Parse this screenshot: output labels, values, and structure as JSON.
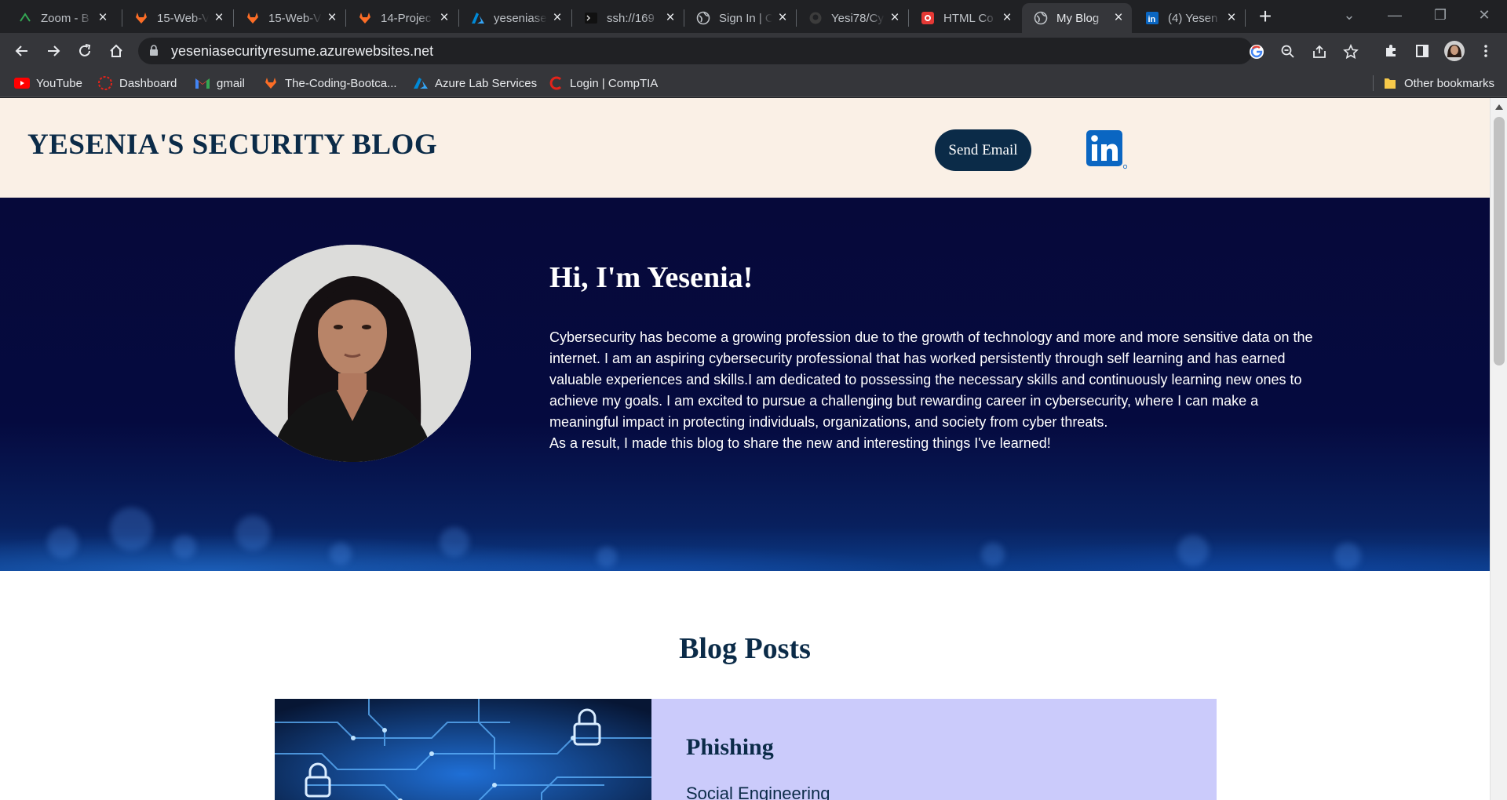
{
  "browser": {
    "tabs": [
      {
        "title": "Zoom - B",
        "icon": "zoom-icon",
        "color": "#2d8cff"
      },
      {
        "title": "15-Web-V",
        "icon": "gitlab-icon",
        "color": "#fc6d26"
      },
      {
        "title": "15-Web-V",
        "icon": "gitlab-icon",
        "color": "#fc6d26"
      },
      {
        "title": "14-Projec",
        "icon": "gitlab-icon",
        "color": "#fc6d26"
      },
      {
        "title": "yeseniase",
        "icon": "azure-icon",
        "color": "#0078d4"
      },
      {
        "title": "ssh://169",
        "icon": "terminal-icon",
        "color": "#1e1e1e"
      },
      {
        "title": "Sign In | C",
        "icon": "globe-icon",
        "color": "#bdc1c6"
      },
      {
        "title": "Yesi78/Cy",
        "icon": "github-icon",
        "color": "#5f6368"
      },
      {
        "title": "HTML Co",
        "icon": "record-icon",
        "color": "#e53935"
      },
      {
        "title": "My Blog",
        "icon": "globe-icon",
        "color": "#bdc1c6",
        "active": true
      },
      {
        "title": "(4) Yesen",
        "icon": "linkedin-icon",
        "color": "#0a66c2"
      }
    ],
    "url": "yeseniasecurityresume.azurewebsites.net",
    "bookmarks": [
      {
        "label": "YouTube",
        "icon": "youtube-icon"
      },
      {
        "label": "Dashboard",
        "icon": "dashboard-icon"
      },
      {
        "label": "gmail",
        "icon": "gmail-icon"
      },
      {
        "label": "The-Coding-Bootca...",
        "icon": "gitlab-icon"
      },
      {
        "label": "Azure Lab Services",
        "icon": "azure-icon"
      },
      {
        "label": "Login | CompTIA",
        "icon": "comptia-icon"
      }
    ],
    "other_bookmarks": "Other bookmarks"
  },
  "site": {
    "title": "YESENIA'S SECURITY BLOG",
    "send_email": "Send Email",
    "linkedin_label": "in",
    "hero": {
      "heading": "Hi, I'm Yesenia!",
      "paragraph1": "Cybersecurity has become a growing profession due to the growth of technology and more and more sensitive data on the internet. I am an aspiring cybersecurity professional that has worked persistently through self learning and has earned valuable experiences and skills.I am dedicated to possessing the necessary skills and continuously learning new ones to achieve my goals. I am excited to pursue a challenging but rewarding career in cybersecurity, where I can make a meaningful impact in protecting individuals, organizations, and society from cyber threats.",
      "paragraph2": "As a result, I made this blog to share the new and interesting things I've learned!"
    },
    "blog_heading": "Blog Posts",
    "posts": [
      {
        "title": "Phishing",
        "subtitle": "Social Engineering"
      }
    ]
  },
  "colors": {
    "navy": "#0b2b48",
    "header_bg": "#faf0e6",
    "post_bg": "#cbcbfb",
    "hero_bg": "#06093a"
  }
}
